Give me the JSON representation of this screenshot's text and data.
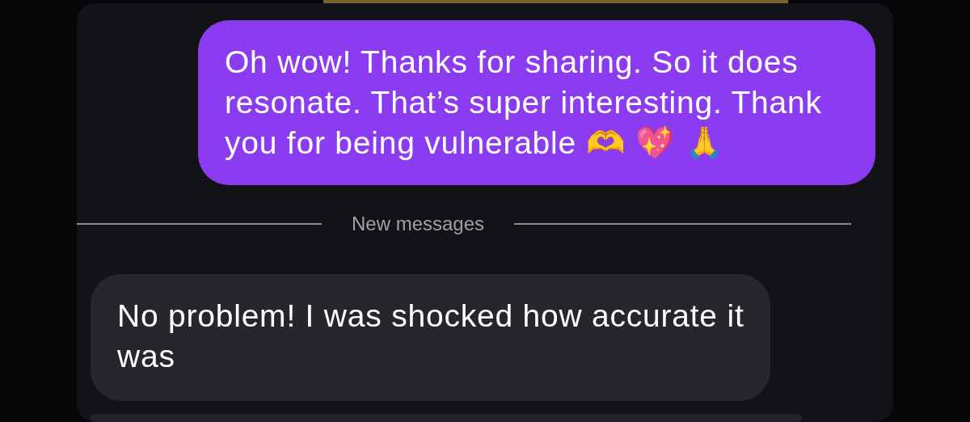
{
  "messages": [
    {
      "kind": "outgoing",
      "text": "Oh wow! Thanks for sharing. So it does resonate. That’s super interesting. Thank you for being vulnerable 🫶 💖 🙏"
    },
    {
      "kind": "divider",
      "text": "New messages"
    },
    {
      "kind": "incoming",
      "text": "No problem! I was shocked how accurate it was"
    }
  ]
}
